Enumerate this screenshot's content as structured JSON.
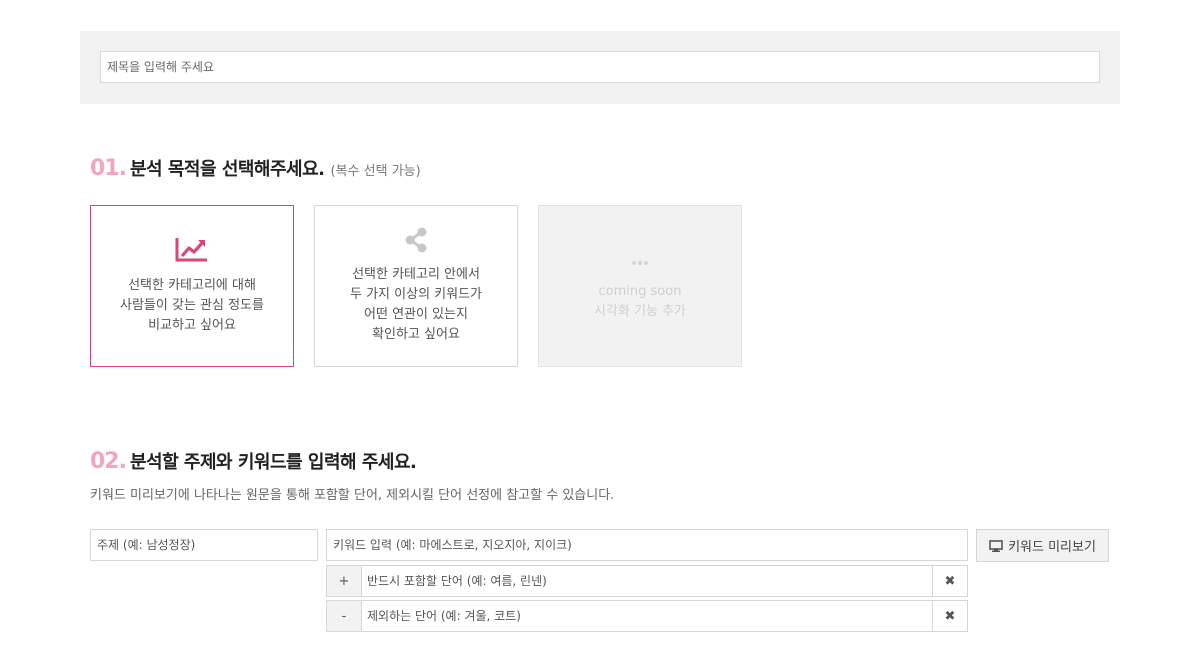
{
  "title_input": {
    "placeholder": "제목을 입력해 주세요"
  },
  "section1": {
    "num": "01.",
    "heading": "분석 목적을 선택해주세요.",
    "sub": "(복수 선택 가능)",
    "cards": [
      {
        "icon": "trend-chart-icon",
        "lines": [
          "선택한 카테고리에 대해",
          "사람들이 갖는 관심 정도를",
          "비교하고 싶어요"
        ],
        "selected": true
      },
      {
        "icon": "share-nodes-icon",
        "lines": [
          "선택한 카테고리 안에서",
          "두 가지 이상의 키워드가",
          "어떤 연관이 있는지",
          "확인하고 싶어요"
        ],
        "selected": false
      },
      {
        "icon": "ellipsis-icon",
        "lines": [
          "coming soon",
          "시각화 기능 추가"
        ],
        "disabled": true
      }
    ]
  },
  "section2": {
    "num": "02.",
    "heading": "분석할 주제와 키워드를 입력해 주세요.",
    "description": "키워드 미리보기에 나타나는 원문을 통해 포함할 단어, 제외시킬 단어 선정에 참고할 수 있습니다.",
    "topic_placeholder": "주제 (예: 남성정장)",
    "keyword_placeholder": "키워드 입력 (예: 마에스트로, 지오지아, 지이크)",
    "preview_button": "키워드 미리보기",
    "include": {
      "sign": "+",
      "placeholder": "반드시 포함할 단어 (예: 여름, 린넨)",
      "clear": "✖"
    },
    "exclude": {
      "sign": "-",
      "placeholder": "제외하는 단어 (예: 겨울, 코트)",
      "clear": "✖"
    }
  },
  "colors": {
    "accent": "#d9467a",
    "number": "#f2a5bd"
  }
}
